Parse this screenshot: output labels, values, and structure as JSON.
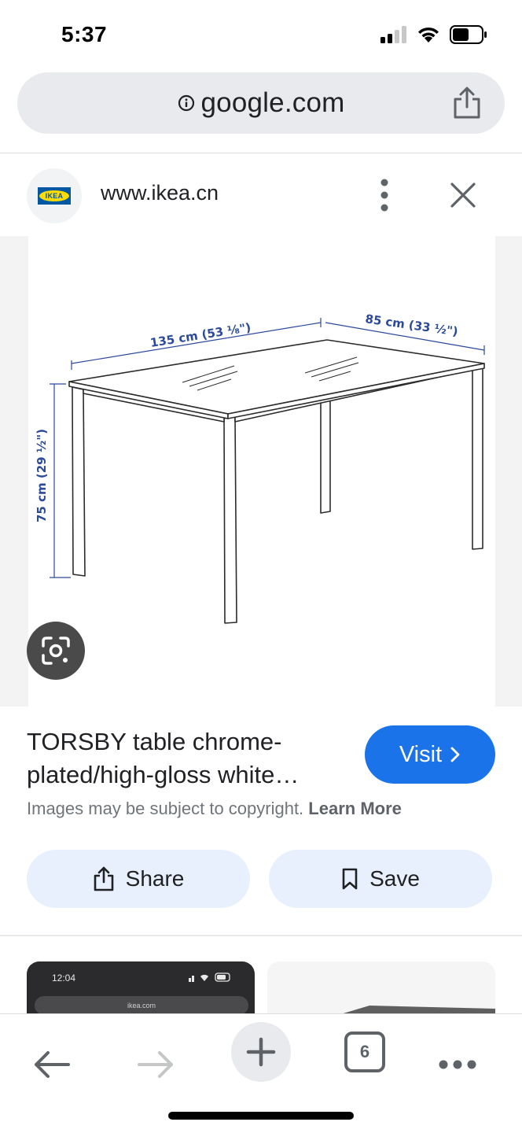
{
  "status_bar": {
    "time": "5:37",
    "icons": [
      "signal-icon",
      "wifi-icon",
      "battery-icon"
    ]
  },
  "url_bar": {
    "domain": "google.com",
    "info_icon": "info-icon",
    "share_icon": "share-icon"
  },
  "source": {
    "logo_text": "IKEA",
    "url": "www.ikea.cn",
    "more_icon": "more-vert-icon",
    "close_icon": "close-icon"
  },
  "image": {
    "dimensions": {
      "width_label": "135 cm (53 ⅛\")",
      "depth_label": "85 cm (33 ½\")",
      "height_label": "75 cm (29 ½\")"
    },
    "lens_icon": "google-lens-icon"
  },
  "result": {
    "title_line1": "TORSBY table chrome-",
    "title_line2": "plated/high-gloss white…",
    "visit_label": "Visit",
    "copyright_text": "Images may be subject to copyright.",
    "learn_more": "Learn More"
  },
  "actions": {
    "share_label": "Share",
    "save_label": "Save"
  },
  "related": {
    "thumb1_time": "12:04",
    "thumb1_url": "ikea.com"
  },
  "toolbar": {
    "tab_count": "6",
    "icons": [
      "back-icon",
      "forward-icon",
      "new-tab-icon",
      "tabs-icon",
      "more-horiz-icon"
    ]
  },
  "colors": {
    "accent": "#1a73e8",
    "pill_bg": "#e8f0fe",
    "url_bar_bg": "#e9eaed",
    "dimension_text": "#2b4a9a"
  }
}
